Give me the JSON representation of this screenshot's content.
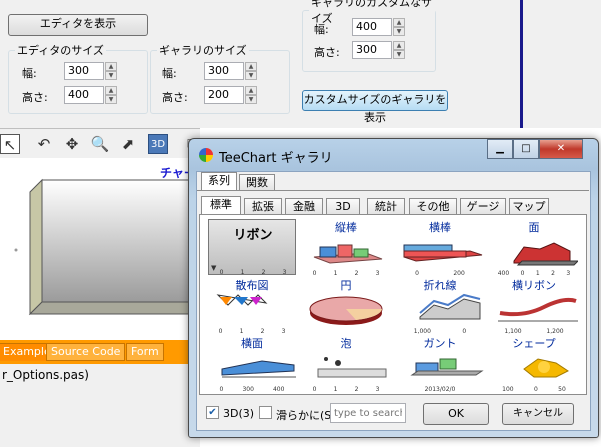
{
  "main": {
    "show_editor_button": "エディタを表示",
    "editor_size": {
      "legend": "エディタのサイズ",
      "width_label": "幅:",
      "width": "300",
      "height_label": "高さ:",
      "height": "400"
    },
    "gallery_size": {
      "legend": "ギャラリのサイズ",
      "width_label": "幅:",
      "width": "300",
      "height_label": "高さ:",
      "height": "200"
    },
    "custom_gallery_size": {
      "legend": "ギャラリのカスタムなサイズ",
      "width_label": "幅:",
      "width": "400",
      "height_label": "高さ:",
      "height": "300"
    },
    "show_custom_gallery_button": "カスタムサイズのギャラリを表示",
    "chart_title_partial": "チャー",
    "bottom_tabs": [
      "Example",
      "Source Code",
      "Form"
    ],
    "status_filename": "r_Options.pas)"
  },
  "dialog": {
    "title": "TeeChart ギャラリ",
    "top_tabs": [
      "系列",
      "関数"
    ],
    "sub_tabs": [
      "標準",
      "拡張",
      "金融",
      "3D",
      "統計",
      "その他",
      "ゲージ",
      "マップ"
    ],
    "gallery_items": [
      {
        "label": "リボン",
        "icon": "ribbon-chart-icon",
        "axis": [
          "0",
          "1",
          "2",
          "3"
        ]
      },
      {
        "label": "縦棒",
        "icon": "bar-chart-icon",
        "axis": [
          "0",
          "1",
          "2",
          "3"
        ]
      },
      {
        "label": "横棒",
        "icon": "horizontal-bar-chart-icon",
        "axis": [
          "0",
          "200"
        ]
      },
      {
        "label": "面",
        "icon": "area-chart-icon",
        "axis": [
          "400",
          "0",
          "1",
          "2",
          "3"
        ]
      },
      {
        "label": "散布図",
        "icon": "scatter-chart-icon",
        "axis": [
          "0",
          "1",
          "2",
          "3"
        ]
      },
      {
        "label": "円",
        "icon": "pie-chart-icon",
        "axis": []
      },
      {
        "label": "折れ線",
        "icon": "line-chart-icon",
        "axis": [
          "1,000",
          "0"
        ]
      },
      {
        "label": "横リボン",
        "icon": "horizontal-ribbon-chart-icon",
        "axis": [
          "1,100",
          "1,200"
        ]
      },
      {
        "label": "横面",
        "icon": "horizontal-area-chart-icon",
        "axis": [
          "0",
          "300",
          "400"
        ]
      },
      {
        "label": "泡",
        "icon": "bubble-chart-icon",
        "axis": [
          "0",
          "1",
          "2",
          "3"
        ]
      },
      {
        "label": "ガント",
        "icon": "gantt-chart-icon",
        "axis": [
          "2013/02/0"
        ]
      },
      {
        "label": "シェープ",
        "icon": "shape-chart-icon",
        "axis": [
          "100",
          "0",
          "50"
        ]
      }
    ],
    "option_3d": {
      "label": "3D(3)",
      "checked": true
    },
    "option_smooth": {
      "label": "滑らかに(S)",
      "checked": false
    },
    "search_placeholder": "type to search",
    "ok_button": "OK",
    "cancel_button": "キャンセル"
  }
}
